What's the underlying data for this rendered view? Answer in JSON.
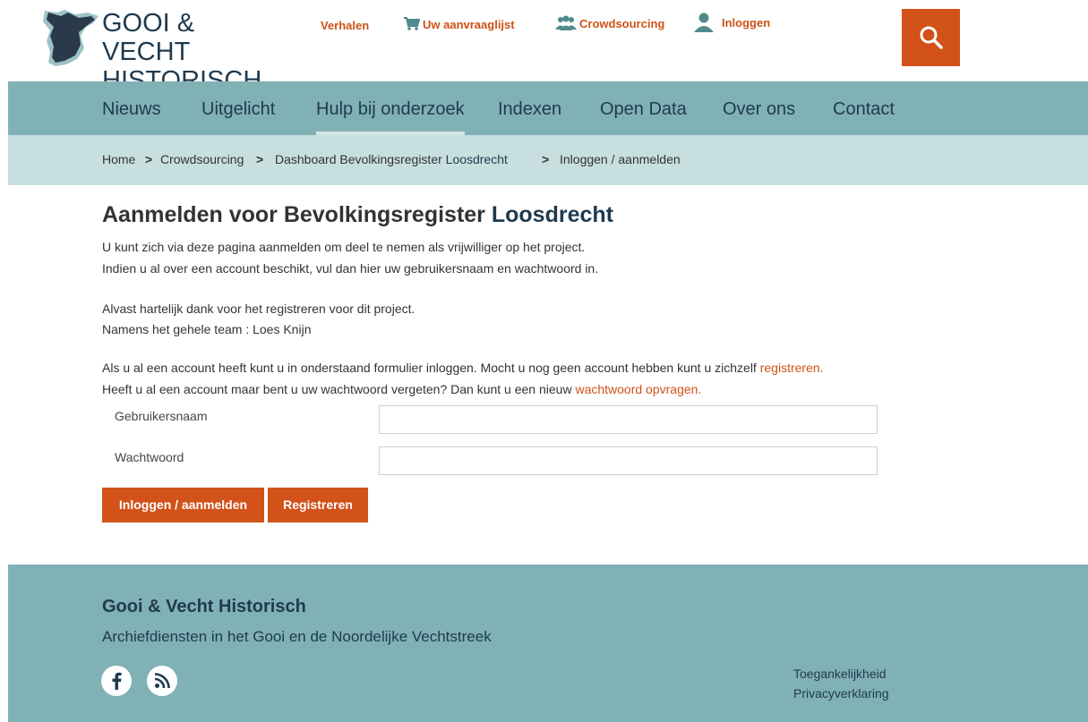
{
  "header": {
    "logo_line1": "GOOI & VECHT",
    "logo_line2": "HISTORISCH",
    "top_links": {
      "verhalen": "Verhalen",
      "aanvraaglijst": "Uw aanvraaglijst",
      "crowdsourcing": "Crowdsourcing",
      "inloggen": "Inloggen"
    }
  },
  "nav": {
    "items": [
      "Nieuws",
      "Uitgelicht",
      "Hulp bij onderzoek",
      "Indexen",
      "Open Data",
      "Over ons",
      "Contact"
    ],
    "active": "Hulp bij onderzoek"
  },
  "breadcrumb": {
    "home": "Home",
    "crowdsourcing": "Crowdsourcing",
    "dashboard_prefix": "Dashboard Bevolkingsregister",
    "dashboard_place": "Loosdrecht",
    "current": "Inloggen / aanmelden",
    "separator": ">"
  },
  "main": {
    "title_prefix": "Aanmelden voor Bevolkingsregister",
    "title_place": "Loosdrecht",
    "intro_line1": "U kunt zich via deze pagina aanmelden om deel te nemen als vrijwilliger op het project.",
    "intro_line2": "Indien u al over een account beschikt, vul dan hier uw gebruikersnaam en wachtwoord in.",
    "thanks_line1": "Alvast hartelijk dank voor het registreren voor dit project.",
    "thanks_line2": "Namens het gehele team : Loes Knijn",
    "account_line1_prefix": "Als u al een account heeft kunt u in onderstaand formulier inloggen. Mocht u nog geen account hebben kunt u zichzelf",
    "account_line1_link": "registreren.",
    "account_line2_prefix": "Heeft u al een account maar bent u uw wachtwoord vergeten? Dan kunt u een nieuw",
    "account_line2_link": "wachtwoord opvragen."
  },
  "form": {
    "username_label": "Gebruikersnaam",
    "username_value": "",
    "password_label": "Wachtwoord",
    "password_value": "",
    "login_button": "Inloggen / aanmelden",
    "register_button": "Registreren"
  },
  "footer": {
    "title": "Gooi & Vecht Historisch",
    "subtitle": "Archiefdiensten in het Gooi en de Noordelijke Vechtstreek",
    "links": [
      "Toegankelijkheid",
      "Privacyverklaring"
    ],
    "social_icons": [
      "facebook-icon",
      "rss-icon"
    ]
  },
  "colors": {
    "accent_orange": "#d2521a",
    "nav_teal": "#80b1b5",
    "breadcrumb_bg": "#c8dfe0",
    "brand_navy": "#1f3a4f"
  }
}
